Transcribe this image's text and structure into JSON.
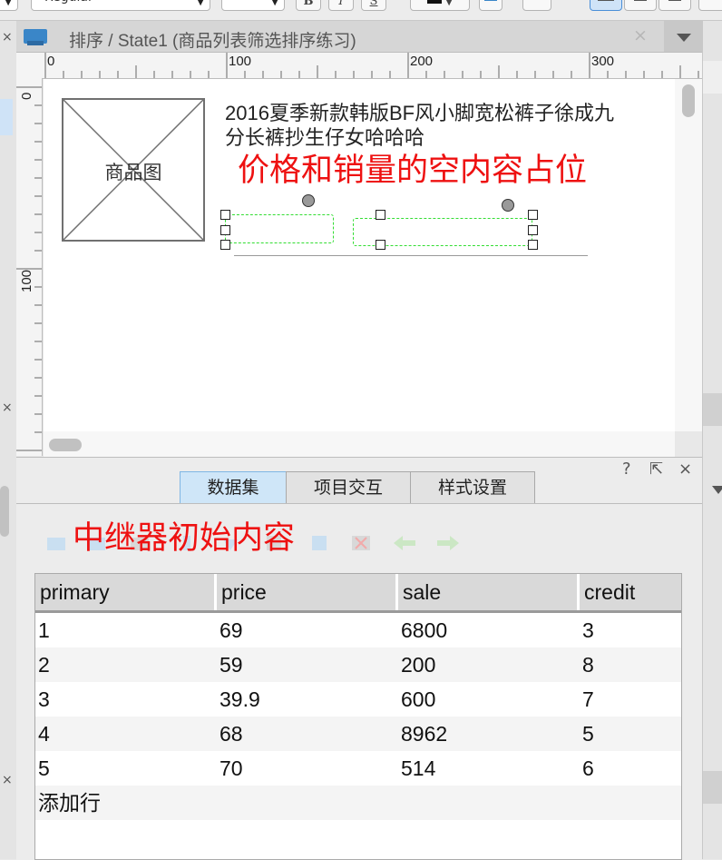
{
  "toolbar": {
    "font_style": "Regular",
    "bold": "B",
    "italic": "I",
    "underline": "S"
  },
  "tab": {
    "title": "排序 / State1 (商品列表筛选排序练习)",
    "close": "×"
  },
  "ruler": {
    "h_ticks": [
      "0",
      "100",
      "200",
      "300"
    ],
    "v_ticks": [
      "0",
      "100"
    ]
  },
  "canvas": {
    "placeholder_label": "商品图",
    "product_title": "2016夏季新款韩版BF风小脚宽松裤子徐成九分长裤抄生仔女哈哈哈",
    "annotation": "价格和销量的空内容占位"
  },
  "panel": {
    "help": "?",
    "popout": "⇱",
    "close": "×",
    "tabs": [
      "数据集",
      "项目交互",
      "样式设置"
    ],
    "annotation": "中继器初始内容",
    "columns": [
      "primary",
      "price",
      "sale",
      "credit"
    ],
    "rows": [
      [
        "1",
        "69",
        "6800",
        "3"
      ],
      [
        "2",
        "59",
        "200",
        "8"
      ],
      [
        "3",
        "39.9",
        "600",
        "7"
      ],
      [
        "4",
        "68",
        "8962",
        "5"
      ],
      [
        "5",
        "70",
        "514",
        "6"
      ]
    ],
    "add_row": "添加行"
  },
  "colors": {
    "accent_blue": "#3a86c8",
    "annotation_red": "#ee1111",
    "selection_green": "#33dd33"
  }
}
